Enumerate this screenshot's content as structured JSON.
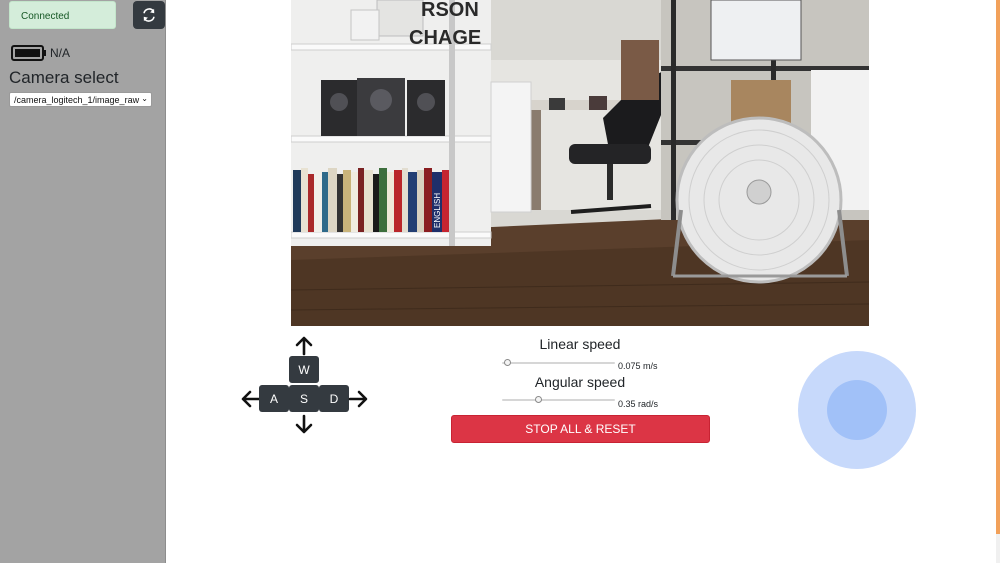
{
  "sidebar": {
    "connection_status": "Connected",
    "refresh_icon": "refresh-icon",
    "battery_icon": "battery-icon",
    "battery_label": "N/A",
    "camera_select_title": "Camera select",
    "camera_select_value": "/camera_logitech_1/image_raw"
  },
  "camera_feed": {
    "alt": "Live camera view of an office room with bookshelves, a desk chair and a floor fan",
    "poster_text": "RSON",
    "poster_text2": "CHAGE",
    "book_spine": "ENGLISH"
  },
  "teleop": {
    "keys": {
      "up": "W",
      "left": "A",
      "down": "S",
      "right": "D"
    },
    "arrows": [
      "arrow-up-icon",
      "arrow-left-icon",
      "arrow-down-icon",
      "arrow-right-icon"
    ]
  },
  "speed": {
    "linear_title": "Linear speed",
    "linear_value": "0.075 m/s",
    "linear_fraction": 0.05,
    "angular_title": "Angular speed",
    "angular_value": "0.35 rad/s",
    "angular_fraction": 0.32
  },
  "actions": {
    "stop_label": "STOP ALL & RESET"
  },
  "colors": {
    "sidebar_bg": "#a3a3a3",
    "connected_bg": "#d4edda",
    "connected_text": "#155724",
    "dark_button": "#343a40",
    "danger": "#dc3545",
    "joystick_base": "#c7d9fb",
    "joystick_knob": "#a1c1f8"
  }
}
